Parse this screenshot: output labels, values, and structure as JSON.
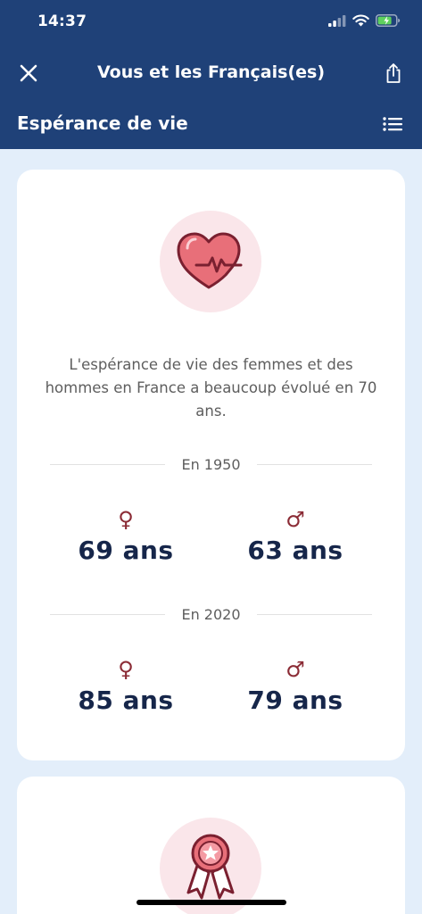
{
  "status_bar": {
    "time": "14:37"
  },
  "nav": {
    "title": "Vous et les Français(es)",
    "close_icon": "close-icon",
    "share_icon": "share-icon"
  },
  "section": {
    "title": "Espérance de vie",
    "menu_icon": "list-icon"
  },
  "card": {
    "icon": "heart-pulse-icon",
    "intro": "L'espérance de vie des femmes et des hommes en France a beaucoup évolué en 70 ans.",
    "periods": [
      {
        "label": "En 1950",
        "female": "69 ans",
        "male": "63 ans"
      },
      {
        "label": "En 2020",
        "female": "85 ans",
        "male": "79 ans"
      }
    ],
    "symbols": {
      "female": "♀",
      "male": "♂"
    }
  },
  "next_card": {
    "icon": "award-ribbon-icon"
  },
  "colors": {
    "header": "#1f4178",
    "background": "#e3eefa",
    "accent": "#8b2b35",
    "value_text": "#16264a"
  }
}
